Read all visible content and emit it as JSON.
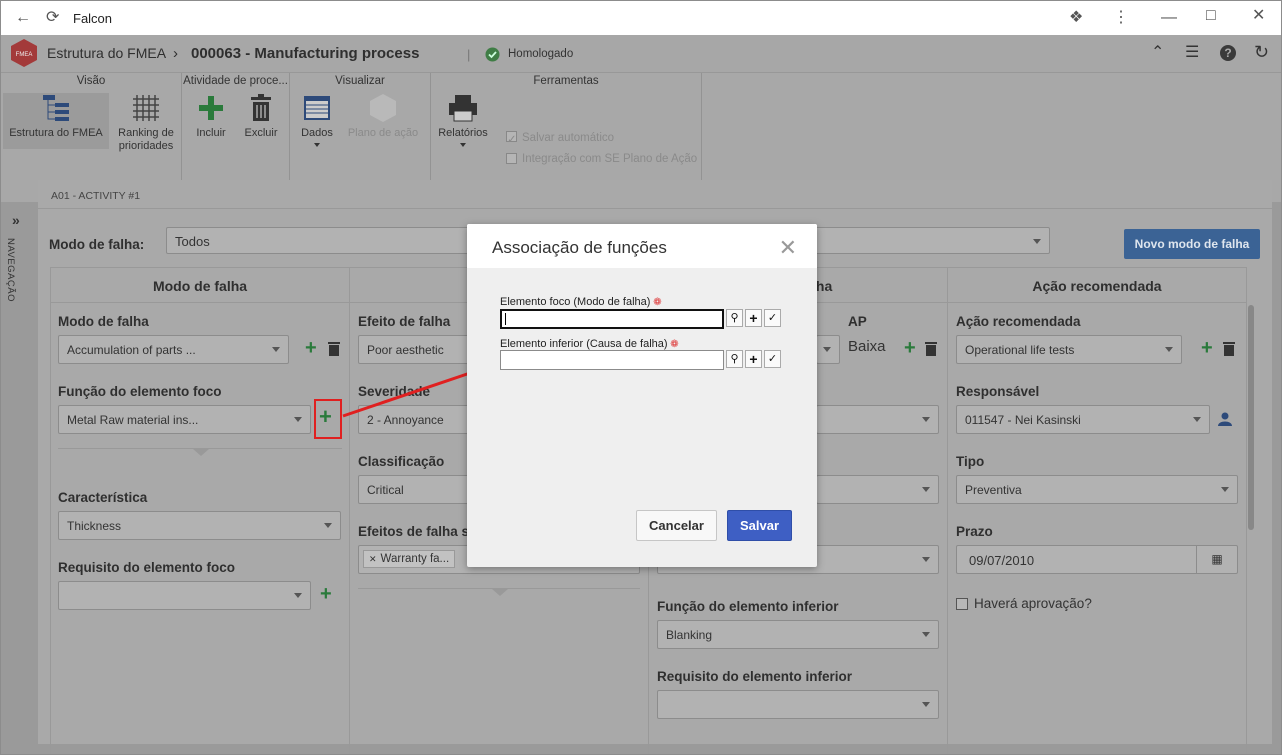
{
  "window": {
    "title": "Falcon"
  },
  "header": {
    "module": "Estrutura do FMEA",
    "record": "000063 - Manufacturing process",
    "status": "Homologado",
    "logo": "FMEA"
  },
  "ribbon": {
    "groups": [
      "Visão",
      "Atividade de proce...",
      "Visualizar",
      "Ferramentas"
    ],
    "buttons": {
      "estrutura": "Estrutura do FMEA",
      "ranking": "Ranking de prioridades",
      "incluir": "Incluir",
      "excluir": "Excluir",
      "dados": "Dados",
      "plano": "Plano de ação",
      "relatorios": "Relatórios"
    },
    "checks": {
      "salvar": "Salvar automático",
      "integracao": "Integração com SE Plano de Ação"
    }
  },
  "sidebar": {
    "label": "NAVEGAÇÃO"
  },
  "content": {
    "activity": "A01 - ACTIVITY #1",
    "filter_label": "Modo de falha:",
    "filter_value": "Todos",
    "new_button": "Novo modo de falha"
  },
  "columns": {
    "c1": {
      "header": "Modo de falha",
      "modo_label": "Modo de falha",
      "modo_value": "Accumulation of parts ...",
      "funcao_label": "Função do elemento foco",
      "funcao_value": "Metal Raw material ins...",
      "carac_label": "Característica",
      "carac_value": "Thickness",
      "req_label": "Requisito do elemento foco",
      "req_value": ""
    },
    "c2": {
      "header": "Efe",
      "efeito_label": "Efeito de falha",
      "efeito_value": "Poor aesthetic",
      "sev_label": "Severidade",
      "sev_value": "2 - Annoyance",
      "class_label": "Classificação",
      "class_value": "Critical",
      "efeitos_label": "Efeitos de falha s",
      "tag": "Warranty fa..."
    },
    "c3": {
      "header": "is de falha",
      "ap_label": "AP",
      "ap_value": "Baixa",
      "func_inf_label": "Função do elemento inferior",
      "func_inf_value": "Blanking",
      "req_inf_label": "Requisito do elemento inferior",
      "req_inf_value": ""
    },
    "c4": {
      "header": "Ação recomendada",
      "acao_label": "Ação recomendada",
      "acao_value": "Operational life tests",
      "resp_label": "Responsável",
      "resp_value": "011547 - Nei Kasinski",
      "tipo_label": "Tipo",
      "tipo_value": "Preventiva",
      "prazo_label": "Prazo",
      "prazo_value": "09/07/2010",
      "aprov_label": "Haverá aprovação?"
    }
  },
  "modal": {
    "title": "Associação de funções",
    "field1_label": "Elemento foco (Modo de falha)",
    "field1_value": "",
    "field2_label": "Elemento inferior (Causa de falha)",
    "field2_value": "",
    "cancel": "Cancelar",
    "save": "Salvar"
  },
  "colors": {
    "accent": "#3e5fc4",
    "plus_green": "#2a7a3b",
    "highlight_red": "#e02020"
  }
}
